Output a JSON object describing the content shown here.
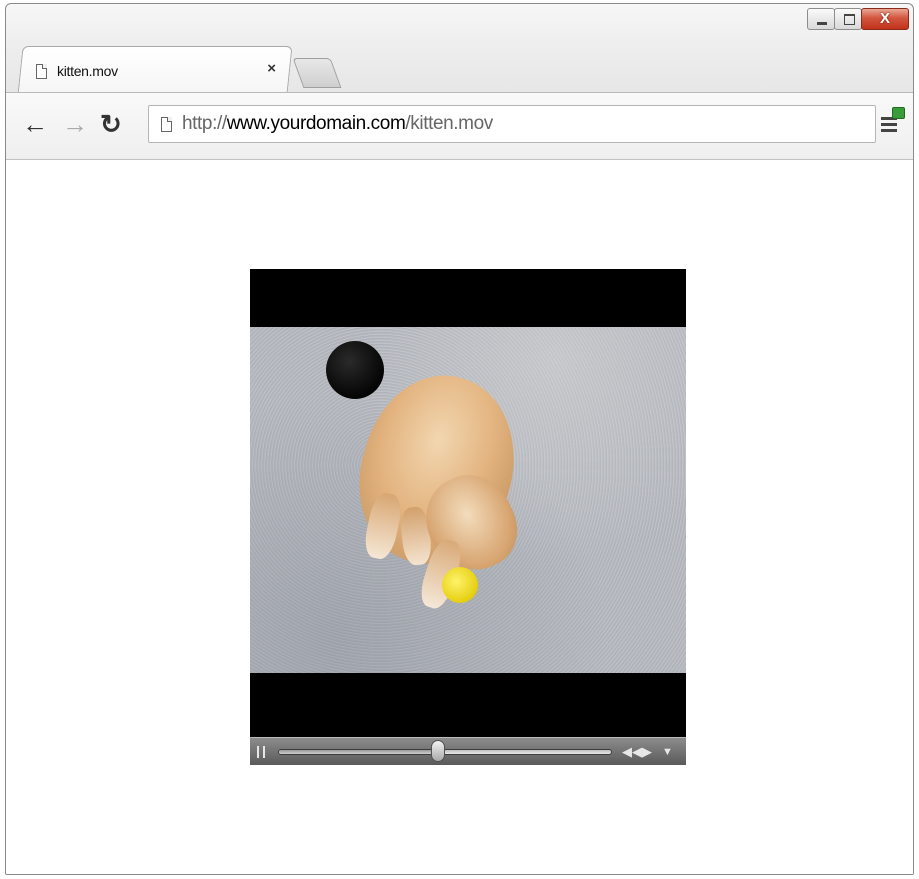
{
  "window": {
    "controls": {
      "close_label": "X"
    }
  },
  "tabs": [
    {
      "title": "kitten.mov",
      "close": "×"
    }
  ],
  "toolbar": {
    "back_icon": "arrow-left",
    "forward_icon": "arrow-right",
    "reload_icon": "reload"
  },
  "address_bar": {
    "scheme": "http://",
    "host": "www.yourdomain.com",
    "path": "/kitten.mov"
  },
  "video": {
    "file": "kitten.mov",
    "playback_state": "playing",
    "progress_fraction": 0.48,
    "frame_description": "kitten-on-carpet-with-toy"
  },
  "colors": {
    "close_button": "#c8452f",
    "video_background": "#000000",
    "toy": "#f2dc22"
  }
}
